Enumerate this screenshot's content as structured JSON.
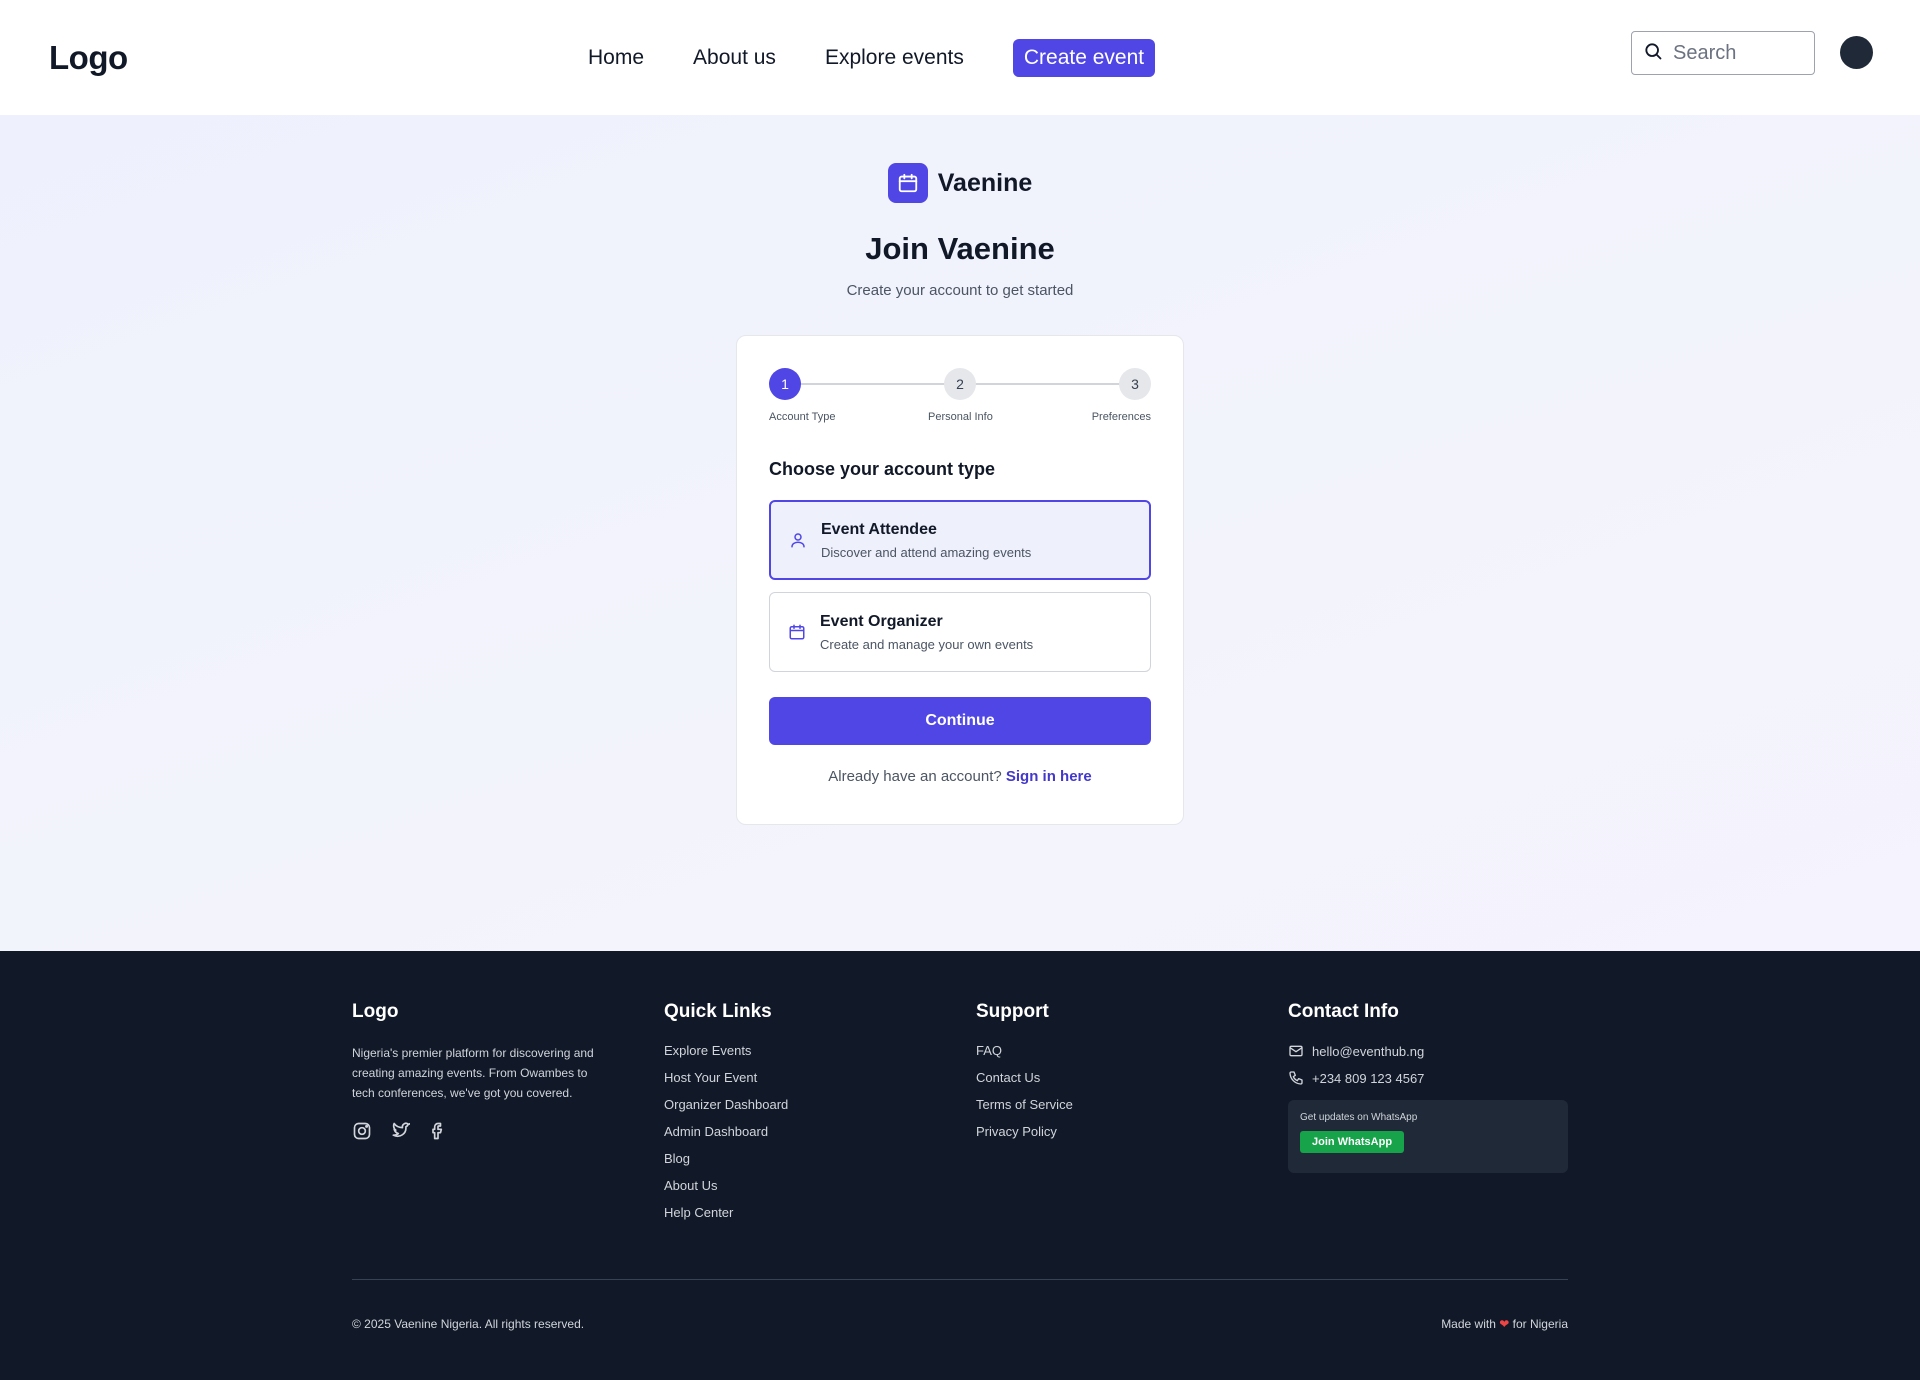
{
  "nav": {
    "logo": "Logo",
    "links": [
      "Home",
      "About us",
      "Explore events"
    ],
    "cta": "Create event",
    "search_placeholder": "Search"
  },
  "brand": {
    "name": "Vaenine",
    "icon": "calendar-icon"
  },
  "hero": {
    "title": "Join Vaenine",
    "subtitle": "Create your account to get started"
  },
  "stepper": {
    "steps": [
      {
        "number": "1",
        "label": "Account Type",
        "active": true
      },
      {
        "number": "2",
        "label": "Personal Info",
        "active": false
      },
      {
        "number": "3",
        "label": "Preferences",
        "active": false
      }
    ]
  },
  "form": {
    "section_title": "Choose your account type",
    "options": [
      {
        "title": "Event Attendee",
        "desc": "Discover and attend amazing events",
        "icon": "user-icon",
        "selected": true
      },
      {
        "title": "Event Organizer",
        "desc": "Create and manage your own events",
        "icon": "calendar-icon",
        "selected": false
      }
    ],
    "continue_label": "Continue",
    "signin_prompt": "Already have an account?",
    "signin_link": "Sign in here"
  },
  "footer": {
    "logo": "Logo",
    "about": "Nigeria's premier platform for discovering and creating amazing events. From Owambes to tech conferences, we've got you covered.",
    "quick_links_title": "Quick Links",
    "quick_links": [
      "Explore Events",
      "Host Your Event",
      "Organizer Dashboard",
      "Admin Dashboard",
      "Blog",
      "About Us",
      "Help Center"
    ],
    "support_title": "Support",
    "support_links": [
      "FAQ",
      "Contact Us",
      "Terms of Service",
      "Privacy Policy"
    ],
    "contact_title": "Contact Info",
    "email": "hello@eventhub.ng",
    "phone": "+234 809 123 4567",
    "whatsapp_text": "Get updates on WhatsApp",
    "whatsapp_button": "Join WhatsApp",
    "copyright": "© 2025 Vaenine Nigeria. All rights reserved.",
    "made_with_prefix": "Made with",
    "made_with_suffix": "for Nigeria"
  },
  "colors": {
    "primary": "#4f46e5",
    "footer_bg": "#111827",
    "whatsapp": "#16a34a",
    "heart": "#ef4444"
  }
}
